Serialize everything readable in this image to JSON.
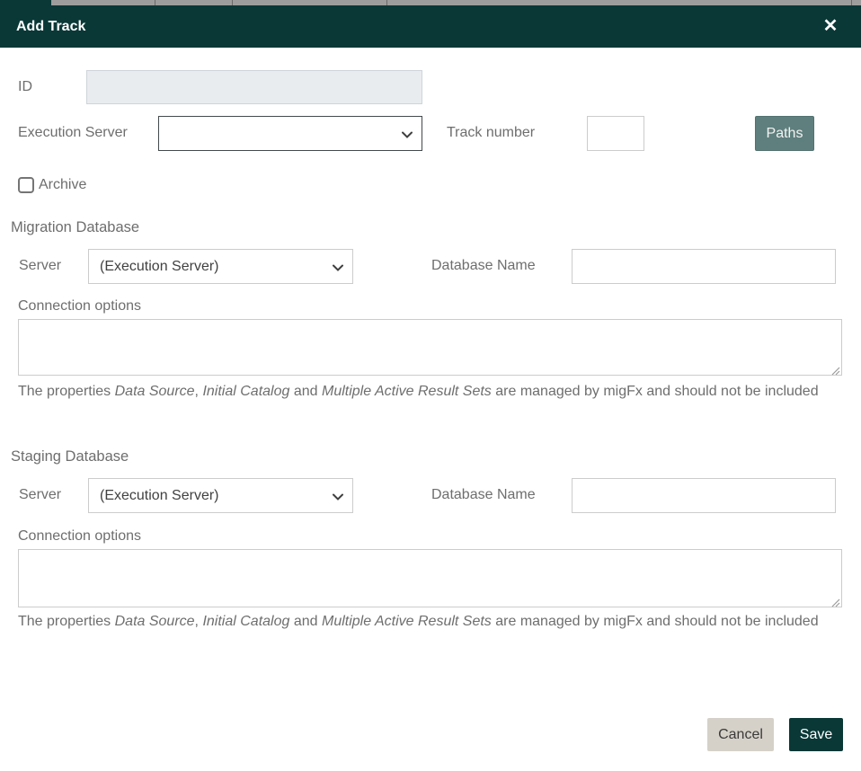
{
  "colors": {
    "header_bg": "#093837",
    "paths_button_bg": "#5e7f7d",
    "save_button_bg": "#093837",
    "cancel_button_bg": "#d5d1c9",
    "label_text": "#6e6e6e",
    "input_border": "#cccccc",
    "dark_select_border": "#43494b",
    "disabled_input_bg": "#e9ecef"
  },
  "modal": {
    "title": "Add Track",
    "close_icon": "✕",
    "row_id": {
      "label": "ID",
      "value": ""
    },
    "row_main": {
      "execution_server_label": "Execution Server",
      "execution_server_value": "",
      "track_number_label": "Track number",
      "track_number_value": "",
      "paths_button_label": "Paths"
    },
    "archive": {
      "label": "Archive",
      "checked": false
    },
    "sections": [
      {
        "title": "Migration Database",
        "server_label": "Server",
        "server_value": "(Execution Server)",
        "database_name_label": "Database Name",
        "database_name_value": "",
        "connection_options_label": "Connection options",
        "connection_options_value": "",
        "note": {
          "p1": "The properties ",
          "i1": "Data Source",
          "p2": ", ",
          "i2": "Initial Catalog",
          "p3": " and ",
          "i3": "Multiple Active Result Sets",
          "p4": " are managed by migFx and should not be included"
        }
      },
      {
        "title": "Staging Database",
        "server_label": "Server",
        "server_value": "(Execution Server)",
        "database_name_label": "Database Name",
        "database_name_value": "",
        "connection_options_label": "Connection options",
        "connection_options_value": "",
        "note": {
          "p1": "The properties ",
          "i1": "Data Source",
          "p2": ", ",
          "i2": "Initial Catalog",
          "p3": " and ",
          "i3": "Multiple Active Result Sets",
          "p4": " are managed by migFx and should not be included"
        }
      }
    ],
    "footer": {
      "cancel_label": "Cancel",
      "save_label": "Save"
    }
  }
}
